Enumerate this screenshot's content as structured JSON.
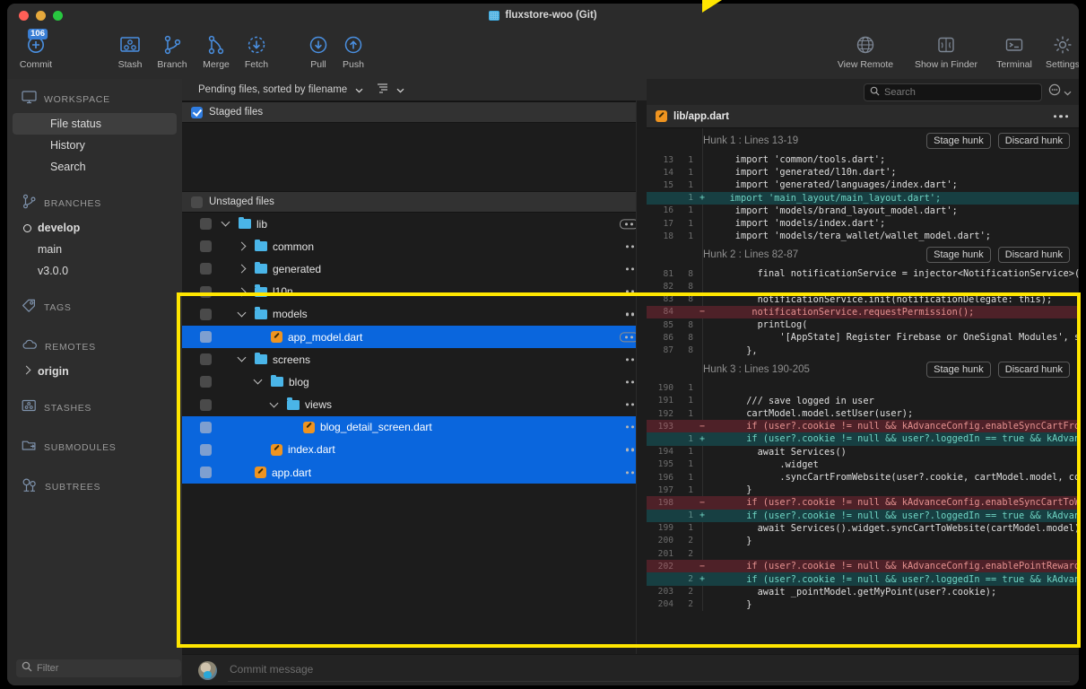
{
  "window": {
    "title": "fluxstore-woo (Git)"
  },
  "toolbar": {
    "items": [
      {
        "label": "Commit",
        "icon": "commit-icon",
        "badge": "106"
      },
      {
        "label": "Stash",
        "icon": "stash-icon"
      },
      {
        "label": "Branch",
        "icon": "branch-icon"
      },
      {
        "label": "Merge",
        "icon": "merge-icon"
      },
      {
        "label": "Fetch",
        "icon": "fetch-icon"
      },
      {
        "label": "Pull",
        "icon": "pull-icon"
      },
      {
        "label": "Push",
        "icon": "push-icon"
      }
    ],
    "right_items": [
      {
        "label": "View Remote",
        "icon": "globe-icon"
      },
      {
        "label": "Show in Finder",
        "icon": "finder-icon"
      },
      {
        "label": "Terminal",
        "icon": "terminal-icon"
      },
      {
        "label": "Settings",
        "icon": "gear-icon"
      }
    ]
  },
  "sidebar": {
    "sections": [
      {
        "label": "WORKSPACE",
        "icon": "monitor-icon"
      },
      {
        "label": "BRANCHES",
        "icon": "branch-icon"
      },
      {
        "label": "TAGS",
        "icon": "tag-icon"
      },
      {
        "label": "REMOTES",
        "icon": "cloud-icon"
      },
      {
        "label": "STASHES",
        "icon": "stash-icon"
      },
      {
        "label": "SUBMODULES",
        "icon": "submodule-icon"
      },
      {
        "label": "SUBTREES",
        "icon": "subtree-icon"
      }
    ],
    "workspace_items": [
      {
        "label": "File status",
        "selected": true
      },
      {
        "label": "History",
        "selected": false
      },
      {
        "label": "Search",
        "selected": false
      }
    ],
    "branches": [
      {
        "label": "develop",
        "current": true
      },
      {
        "label": "main",
        "current": false
      },
      {
        "label": "v3.0.0",
        "current": false
      }
    ],
    "remotes": [
      {
        "label": "origin"
      }
    ],
    "filter_placeholder": "Filter"
  },
  "files_pane": {
    "sort_label": "Pending files, sorted by filename",
    "staged_group": "Staged files",
    "unstaged_group": "Unstaged files",
    "rows": [
      {
        "name": "lib",
        "type": "folder",
        "depth": 0,
        "expanded": true,
        "selected": false,
        "boxed_dots": true
      },
      {
        "name": "common",
        "type": "folder",
        "depth": 1,
        "expanded": false,
        "selected": false
      },
      {
        "name": "generated",
        "type": "folder",
        "depth": 1,
        "expanded": false,
        "selected": false
      },
      {
        "name": "l10n",
        "type": "folder",
        "depth": 1,
        "expanded": false,
        "selected": false
      },
      {
        "name": "models",
        "type": "folder",
        "depth": 1,
        "expanded": true,
        "selected": false
      },
      {
        "name": "app_model.dart",
        "type": "file",
        "depth": 2,
        "selected": true,
        "boxed_dots": true
      },
      {
        "name": "screens",
        "type": "folder",
        "depth": 1,
        "expanded": true,
        "selected": false
      },
      {
        "name": "blog",
        "type": "folder",
        "depth": 2,
        "expanded": true,
        "selected": false
      },
      {
        "name": "views",
        "type": "folder",
        "depth": 3,
        "expanded": true,
        "selected": false
      },
      {
        "name": "blog_detail_screen.dart",
        "type": "file",
        "depth": 4,
        "selected": true
      },
      {
        "name": "index.dart",
        "type": "file",
        "depth": 2,
        "selected": true
      },
      {
        "name": "app.dart",
        "type": "file",
        "depth": 1,
        "selected": true
      }
    ]
  },
  "diff": {
    "search_placeholder": "Search",
    "file_path": "lib/app.dart",
    "stage_hunk_label": "Stage hunk",
    "discard_hunk_label": "Discard hunk",
    "hunks": [
      {
        "title": "Hunk 1 : Lines 13-19",
        "lines": [
          {
            "old": "13",
            "new": "1",
            "sign": "",
            "kind": "ctx",
            "text": "    import 'common/tools.dart';"
          },
          {
            "old": "14",
            "new": "1",
            "sign": "",
            "kind": "ctx",
            "text": "    import 'generated/l10n.dart';"
          },
          {
            "old": "15",
            "new": "1",
            "sign": "",
            "kind": "ctx",
            "text": "    import 'generated/languages/index.dart';"
          },
          {
            "old": "",
            "new": "1",
            "sign": "+",
            "kind": "add",
            "text": "   import 'main_layout/main_layout.dart';"
          },
          {
            "old": "16",
            "new": "1",
            "sign": "",
            "kind": "ctx",
            "text": "    import 'models/brand_layout_model.dart';"
          },
          {
            "old": "17",
            "new": "1",
            "sign": "",
            "kind": "ctx",
            "text": "    import 'models/index.dart';"
          },
          {
            "old": "18",
            "new": "1",
            "sign": "",
            "kind": "ctx",
            "text": "    import 'models/tera_wallet/wallet_model.dart';"
          }
        ]
      },
      {
        "title": "Hunk 2 : Lines 82-87",
        "lines": [
          {
            "old": "81",
            "new": "8",
            "sign": "",
            "kind": "ctx",
            "text": "        final notificationService = injector<NotificationService>();"
          },
          {
            "old": "82",
            "new": "8",
            "sign": "",
            "kind": "ctx",
            "text": ""
          },
          {
            "old": "83",
            "new": "8",
            "sign": "",
            "kind": "ctx",
            "text": "        notificationService.init(notificationDelegate: this);"
          },
          {
            "old": "84",
            "new": "",
            "sign": "−",
            "kind": "del",
            "text": "       notificationService.requestPermission();"
          },
          {
            "old": "85",
            "new": "8",
            "sign": "",
            "kind": "ctx",
            "text": "        printLog("
          },
          {
            "old": "86",
            "new": "8",
            "sign": "",
            "kind": "ctx",
            "text": "            '[AppState] Register Firebase or OneSignal Modules', startTi"
          },
          {
            "old": "87",
            "new": "8",
            "sign": "",
            "kind": "ctx",
            "text": "      },"
          }
        ]
      },
      {
        "title": "Hunk 3 : Lines 190-205",
        "lines": [
          {
            "old": "190",
            "new": "1",
            "sign": "",
            "kind": "ctx",
            "text": ""
          },
          {
            "old": "191",
            "new": "1",
            "sign": "",
            "kind": "ctx",
            "text": "      /// save logged in user"
          },
          {
            "old": "192",
            "new": "1",
            "sign": "",
            "kind": "ctx",
            "text": "      cartModel.model.setUser(user);"
          },
          {
            "old": "193",
            "new": "",
            "sign": "−",
            "kind": "del",
            "text": "      if (user?.cookie != null && kAdvanceConfig.enableSyncCartFromWebsite)"
          },
          {
            "old": "",
            "new": "1",
            "sign": "+",
            "kind": "add",
            "text": "      if (user?.cookie != null && user?.loggedIn == true && kAdvanceConfig."
          },
          {
            "old": "194",
            "new": "1",
            "sign": "",
            "kind": "ctx",
            "text": "        await Services()"
          },
          {
            "old": "195",
            "new": "1",
            "sign": "",
            "kind": "ctx",
            "text": "            .widget"
          },
          {
            "old": "196",
            "new": "1",
            "sign": "",
            "kind": "ctx",
            "text": "            .syncCartFromWebsite(user?.cookie, cartModel.model, context);"
          },
          {
            "old": "197",
            "new": "1",
            "sign": "",
            "kind": "ctx",
            "text": "      }"
          },
          {
            "old": "198",
            "new": "",
            "sign": "−",
            "kind": "del",
            "text": "      if (user?.cookie != null && kAdvanceConfig.enableSyncCartToWebsite) "
          },
          {
            "old": "",
            "new": "1",
            "sign": "+",
            "kind": "add",
            "text": "      if (user?.cookie != null && user?.loggedIn == true && kAdvanceConfig"
          },
          {
            "old": "199",
            "new": "1",
            "sign": "",
            "kind": "ctx",
            "text": "        await Services().widget.syncCartToWebsite(cartModel.model);"
          },
          {
            "old": "200",
            "new": "2",
            "sign": "",
            "kind": "ctx",
            "text": "      }"
          },
          {
            "old": "201",
            "new": "2",
            "sign": "",
            "kind": "ctx",
            "text": ""
          },
          {
            "old": "202",
            "new": "",
            "sign": "−",
            "kind": "del",
            "text": "      if (user?.cookie != null && kAdvanceConfig.enablePointReward) {"
          },
          {
            "old": "",
            "new": "2",
            "sign": "+",
            "kind": "add",
            "text": "      if (user?.cookie != null && user?.loggedIn == true && kAdvanceConfig"
          },
          {
            "old": "203",
            "new": "2",
            "sign": "",
            "kind": "ctx",
            "text": "        await _pointModel.getMyPoint(user?.cookie);"
          },
          {
            "old": "204",
            "new": "2",
            "sign": "",
            "kind": "ctx",
            "text": "      }"
          }
        ]
      }
    ]
  },
  "commit_bar": {
    "placeholder": "Commit message"
  },
  "colors": {
    "accent": "#0a66dd",
    "highlight": "#ffe600",
    "add": "#173f42",
    "del": "#4e2128",
    "folder": "#4ab5e8",
    "file": "#ef9420"
  }
}
